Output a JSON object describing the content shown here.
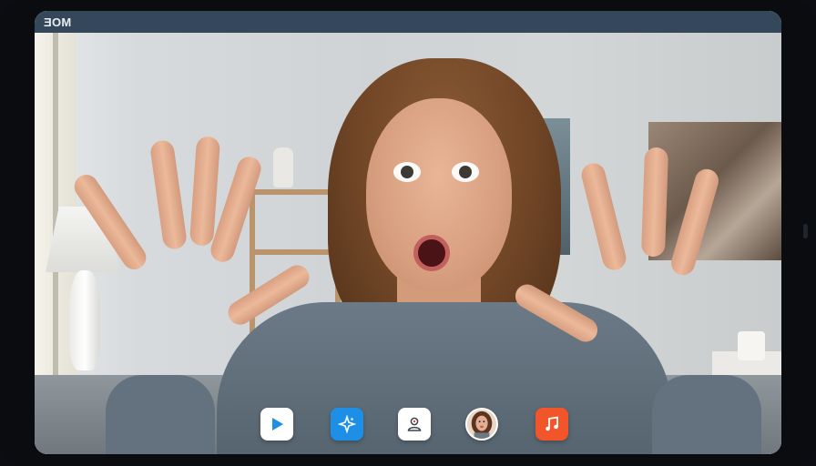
{
  "header": {
    "title": "ƎOM"
  },
  "dock": {
    "buttons": [
      {
        "id": "play",
        "icon": "play-icon",
        "color": "#1e8fe6"
      },
      {
        "id": "effects",
        "icon": "sparkle-icon",
        "color": "#1e8fe6"
      },
      {
        "id": "profile",
        "icon": "user-icon",
        "color": "#ffffff"
      },
      {
        "id": "avatar",
        "icon": "avatar-icon",
        "color": "#f3e6d8"
      },
      {
        "id": "music",
        "icon": "music-note-icon",
        "color": "#f2552a"
      }
    ]
  },
  "colors": {
    "topbar": "#35475a",
    "accent_blue": "#1e8fe6",
    "accent_orange": "#f2552a"
  }
}
